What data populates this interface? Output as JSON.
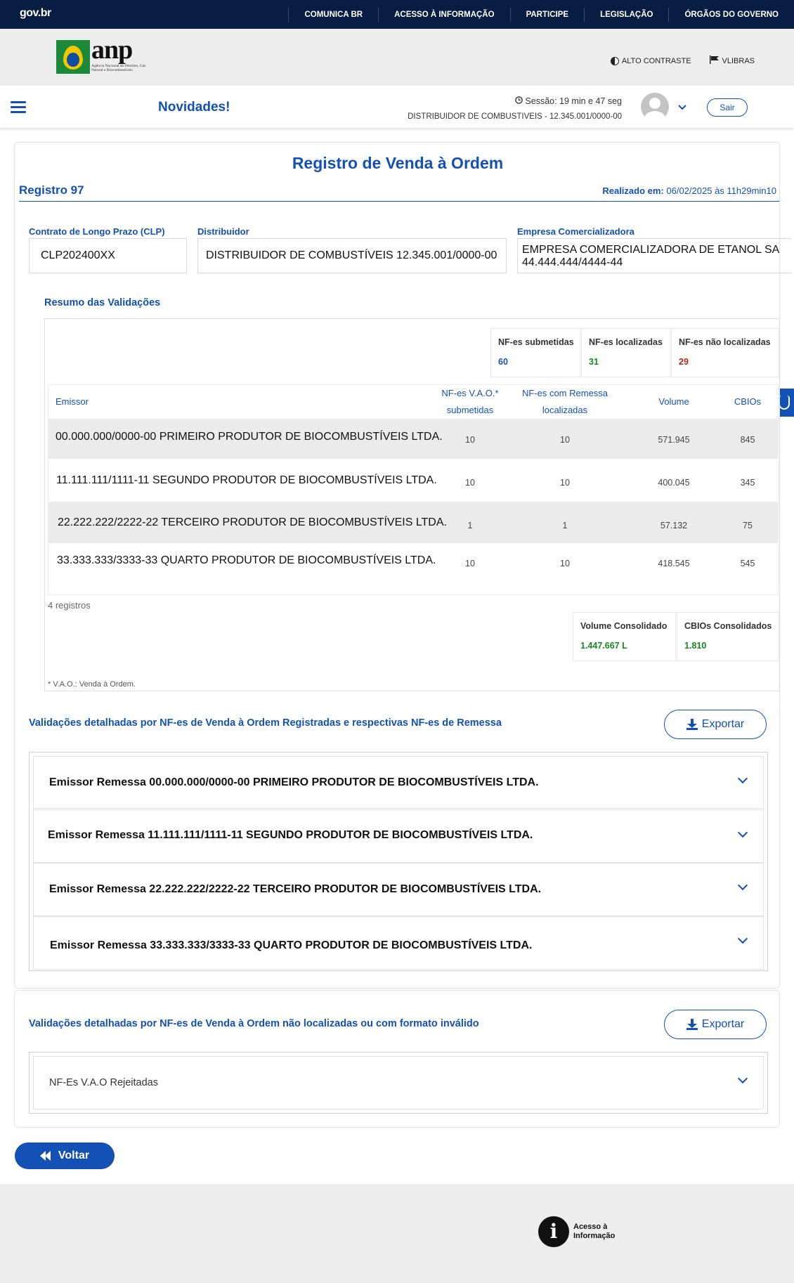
{
  "govbar": {
    "logo": "gov.br",
    "links": [
      "COMUNICA BR",
      "ACESSO À INFORMAÇÃO",
      "PARTICIPE",
      "LEGISLAÇÃO",
      "ÓRGÃOS DO GOVERNO"
    ]
  },
  "header": {
    "logo_text": "anp",
    "logo_sub": "Agência Nacional do Petróleo, Gás Natural e Biocombustíveis",
    "alto_contraste": "ALTO CONTRASTE",
    "vlibras": "VLIBRAS"
  },
  "appbar": {
    "title": "Novidades!",
    "session": "Sessão: 19 min e 47 seg",
    "distribuidor": "DISTRIBUIDOR DE COMBUSTIVEIS - 12.345.001/0000-00",
    "sair": "Sair"
  },
  "page": {
    "title": "Registro de Venda à Ordem",
    "registro": "Registro 97",
    "realizado_label": "Realizado em:",
    "realizado_value": "06/02/2025 às 11h29min10"
  },
  "fields": {
    "clp_label": "Contrato de Longo Prazo (CLP)",
    "clp_value": "CLP202400XX",
    "distribuidor_label": "Distribuidor",
    "distribuidor_value": "DISTRIBUIDOR DE COMBUSTÍVEIS 12.345.001/0000-00",
    "empresa_label": "Empresa Comercializadora",
    "empresa_value_1": "EMPRESA COMERCIALIZADORA DE ETANOL SA",
    "empresa_value_2": "44.444.444/4444-44"
  },
  "summary": {
    "title": "Resumo das Validações",
    "kpis": [
      {
        "label": "NF-es submetidas",
        "value": "60",
        "color": "#1351b4"
      },
      {
        "label": "NF-es localizadas",
        "value": "31",
        "color": "#168821"
      },
      {
        "label": "NF-es não localizadas",
        "value": "29",
        "color": "#b3261e"
      }
    ],
    "headers": {
      "emissor": "Emissor",
      "vao_1": "NF-es V.A.O.*",
      "vao_2": "submetidas",
      "remessa_1": "NF-es com Remessa",
      "remessa_2": "localizadas",
      "volume": "Volume",
      "cbios": "CBIOs"
    },
    "rows": [
      {
        "emissor": "00.000.000/0000-00 PRIMEIRO PRODUTOR DE BIOCOMBUSTÍVEIS LTDA.",
        "vao": "10",
        "remessa": "10",
        "volume": "571.945",
        "cbios": "845"
      },
      {
        "emissor": "11.111.111/1111-11 SEGUNDO PRODUTOR DE BIOCOMBUSTÍVEIS LTDA.",
        "vao": "10",
        "remessa": "10",
        "volume": "400.045",
        "cbios": "345"
      },
      {
        "emissor": "22.222.222/2222-22 TERCEIRO PRODUTOR DE BIOCOMBUSTÍVEIS LTDA.",
        "vao": "1",
        "remessa": "1",
        "volume": "57.132",
        "cbios": "75"
      },
      {
        "emissor": "33.333.333/3333-33 QUARTO PRODUTOR DE BIOCOMBUSTÍVEIS LTDA.",
        "vao": "10",
        "remessa": "10",
        "volume": "418.545",
        "cbios": "545"
      }
    ],
    "count": "4 registros",
    "volume_consolidado_label": "Volume Consolidado",
    "volume_consolidado_value": "1.447.667 L",
    "cbios_consolidados_label": "CBIOs Consolidados",
    "cbios_consolidados_value": "1.810",
    "footnote": "* V.A.O.: Venda à Ordem."
  },
  "detailed": {
    "title": "Validações detalhadas por NF-es de Venda à Ordem Registradas e respectivas NF-es de Remessa",
    "export": "Exportar",
    "items": [
      "Emissor Remessa 00.000.000/0000-00 PRIMEIRO PRODUTOR DE BIOCOMBUSTÍVEIS LTDA.",
      "Emissor Remessa 11.111.111/1111-11 SEGUNDO PRODUTOR DE BIOCOMBUSTÍVEIS LTDA.",
      "Emissor Remessa 22.222.222/2222-22 TERCEIRO PRODUTOR DE BIOCOMBUSTÍVEIS LTDA.",
      "Emissor Remessa 33.333.333/3333-33 QUARTO PRODUTOR DE BIOCOMBUSTÍVEIS LTDA."
    ]
  },
  "rejected": {
    "title": "Validações detalhadas por NF-es de Venda à Ordem não localizadas ou com formato inválido",
    "export": "Exportar",
    "item": "NF-Es V.A.O Rejeitadas"
  },
  "voltar": "Voltar",
  "footer": {
    "ai_line1": "Acesso à",
    "ai_line2": "Informação"
  }
}
